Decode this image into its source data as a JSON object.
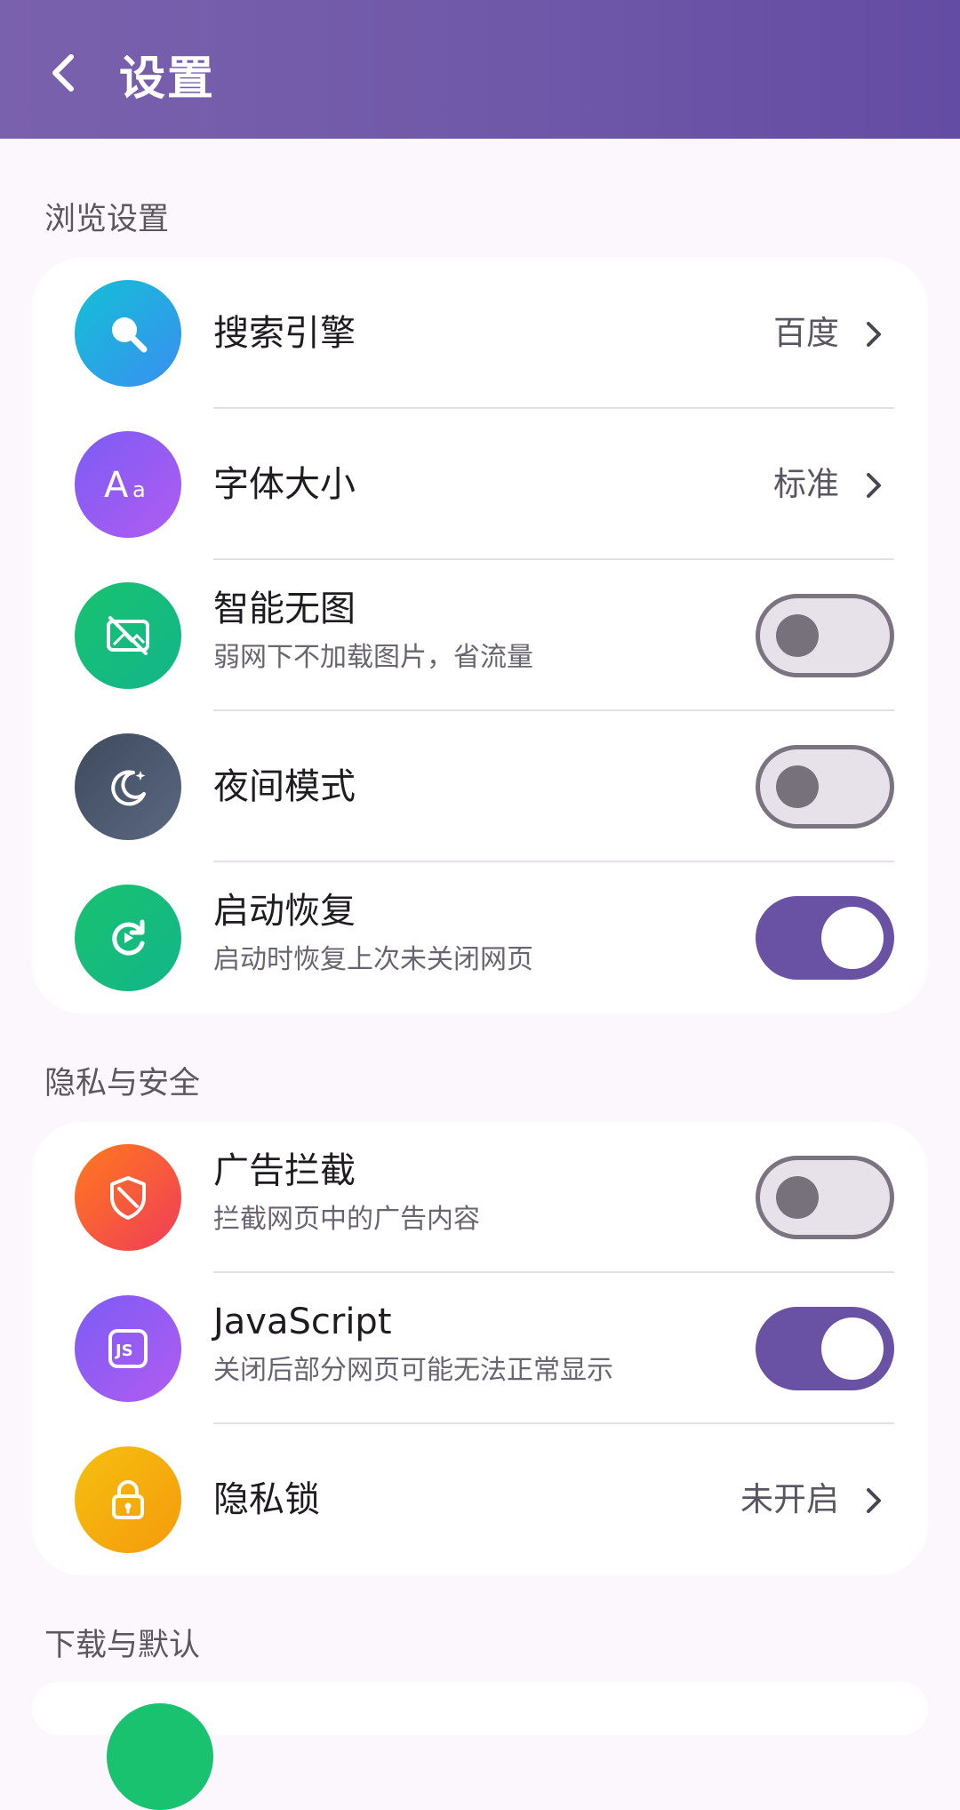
{
  "appbar": {
    "title": "设置",
    "color": "#6f58a8"
  },
  "sections": {
    "browse": {
      "title": "浏览设置",
      "items": [
        {
          "title": "搜索引擎",
          "value": "百度",
          "icon": "search-icon",
          "color": "#1fb5e0"
        },
        {
          "title": "字体大小",
          "value": "标准",
          "icon": "font-size-icon",
          "color": "#8b5cf6"
        },
        {
          "title": "智能无图",
          "subtitle": "弱网下不加载图片，省流量",
          "icon": "no-image-icon",
          "color": "#1fbf77",
          "toggle": false
        },
        {
          "title": "夜间模式",
          "icon": "moon-icon",
          "color": "#4b5568",
          "toggle": false
        },
        {
          "title": "启动恢复",
          "subtitle": "启动时恢复上次未关闭网页",
          "icon": "restore-icon",
          "color": "#1fbf77",
          "toggle": true
        }
      ]
    },
    "privacy": {
      "title": "隐私与安全",
      "items": [
        {
          "title": "广告拦截",
          "subtitle": "拦截网页中的广告内容",
          "icon": "ad-block-icon",
          "color": "#f2533f",
          "toggle": false
        },
        {
          "title": "JavaScript",
          "subtitle": "关闭后部分网页可能无法正常显示",
          "icon": "javascript-icon",
          "color": "#8b5cf6",
          "toggle": true
        },
        {
          "title": "隐私锁",
          "value": "未开启",
          "icon": "lock-icon",
          "color": "#f2a50c"
        }
      ]
    },
    "download": {
      "title": "下载与默认"
    }
  }
}
